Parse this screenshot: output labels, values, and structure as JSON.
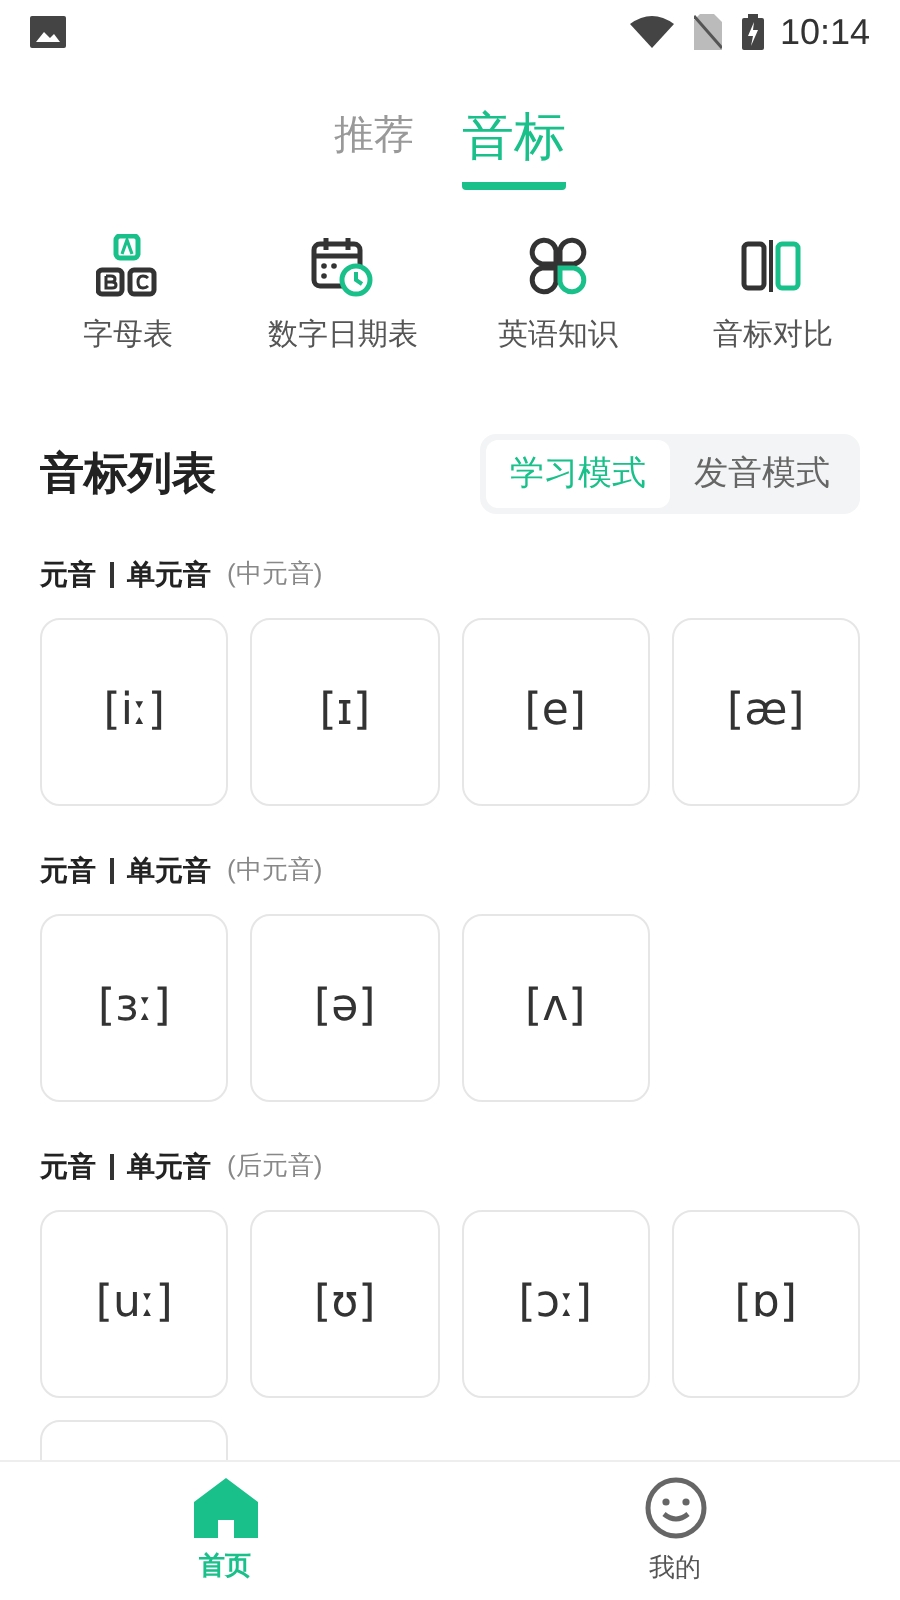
{
  "status_bar": {
    "time": "10:14"
  },
  "top_tabs": [
    {
      "label": "推荐",
      "selected": false
    },
    {
      "label": "音标",
      "selected": true
    }
  ],
  "shortcuts": [
    {
      "label": "字母表",
      "kind": "blocks"
    },
    {
      "label": "数字日期表",
      "kind": "calendar"
    },
    {
      "label": "英语知识",
      "kind": "clover"
    },
    {
      "label": "音标对比",
      "kind": "compare"
    }
  ],
  "list_header": {
    "title": "音标列表",
    "modes": [
      {
        "label": "学习模式",
        "selected": true
      },
      {
        "label": "发音模式",
        "selected": false
      }
    ]
  },
  "sections": [
    {
      "title": "元音",
      "subtitle": "单元音",
      "note": "(中元音)",
      "cards": [
        {
          "kind": "symbol",
          "symbol": "[iː]"
        },
        {
          "kind": "symbol",
          "symbol": "[ɪ]"
        },
        {
          "kind": "symbol",
          "symbol": "[e]"
        },
        {
          "kind": "symbol",
          "symbol": "[æ]"
        }
      ]
    },
    {
      "title": "元音",
      "subtitle": "单元音",
      "note": "(中元音)",
      "cards": [
        {
          "kind": "symbol",
          "symbol": "[ɜː]"
        },
        {
          "kind": "symbol",
          "symbol": "[ə]"
        },
        {
          "kind": "symbol",
          "symbol": "[ʌ]"
        }
      ]
    },
    {
      "title": "元音",
      "subtitle": "单元音",
      "note": "(后元音)",
      "cards": [
        {
          "kind": "symbol",
          "symbol": "[uː]"
        },
        {
          "kind": "symbol",
          "symbol": "[ʊ]"
        },
        {
          "kind": "symbol",
          "symbol": "[ɔː]"
        },
        {
          "kind": "symbol",
          "symbol": "[ɒ]"
        },
        {
          "kind": "hidden"
        }
      ]
    }
  ],
  "bottom_nav": [
    {
      "label": "首页",
      "kind": "home",
      "selected": true
    },
    {
      "label": "我的",
      "kind": "smile",
      "selected": false
    }
  ]
}
